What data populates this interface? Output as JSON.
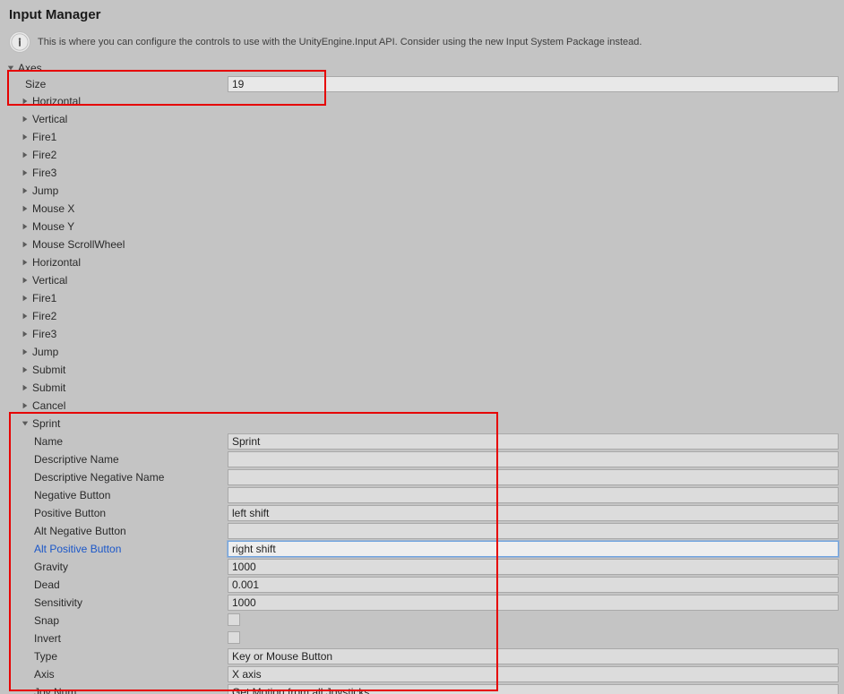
{
  "panel": {
    "title": "Input Manager",
    "info": "This is where you can configure the controls to use with the UnityEngine.Input API. Consider using the new Input System Package instead."
  },
  "axes": {
    "header": "Axes",
    "size_label": "Size",
    "size_value": "19",
    "items": [
      "Horizontal",
      "Vertical",
      "Fire1",
      "Fire2",
      "Fire3",
      "Jump",
      "Mouse X",
      "Mouse Y",
      "Mouse ScrollWheel",
      "Horizontal",
      "Vertical",
      "Fire1",
      "Fire2",
      "Fire3",
      "Jump",
      "Submit",
      "Submit",
      "Cancel"
    ],
    "expanded": {
      "header": "Sprint",
      "fields": {
        "name": {
          "label": "Name",
          "value": "Sprint"
        },
        "desc_name": {
          "label": "Descriptive Name",
          "value": ""
        },
        "desc_neg_name": {
          "label": "Descriptive Negative Name",
          "value": ""
        },
        "neg_button": {
          "label": "Negative Button",
          "value": ""
        },
        "pos_button": {
          "label": "Positive Button",
          "value": "left shift"
        },
        "alt_neg_button": {
          "label": "Alt Negative Button",
          "value": ""
        },
        "alt_pos_button": {
          "label": "Alt Positive Button",
          "value": "right shift"
        },
        "gravity": {
          "label": "Gravity",
          "value": "1000"
        },
        "dead": {
          "label": "Dead",
          "value": "0.001"
        },
        "sensitivity": {
          "label": "Sensitivity",
          "value": "1000"
        },
        "snap": {
          "label": "Snap",
          "checked": false
        },
        "invert": {
          "label": "Invert",
          "checked": false
        },
        "type": {
          "label": "Type",
          "value": "Key or Mouse Button"
        },
        "axis": {
          "label": "Axis",
          "value": "X axis"
        },
        "joynum": {
          "label": "Joy Num",
          "value": "Get Motion from all Joysticks"
        }
      }
    }
  }
}
